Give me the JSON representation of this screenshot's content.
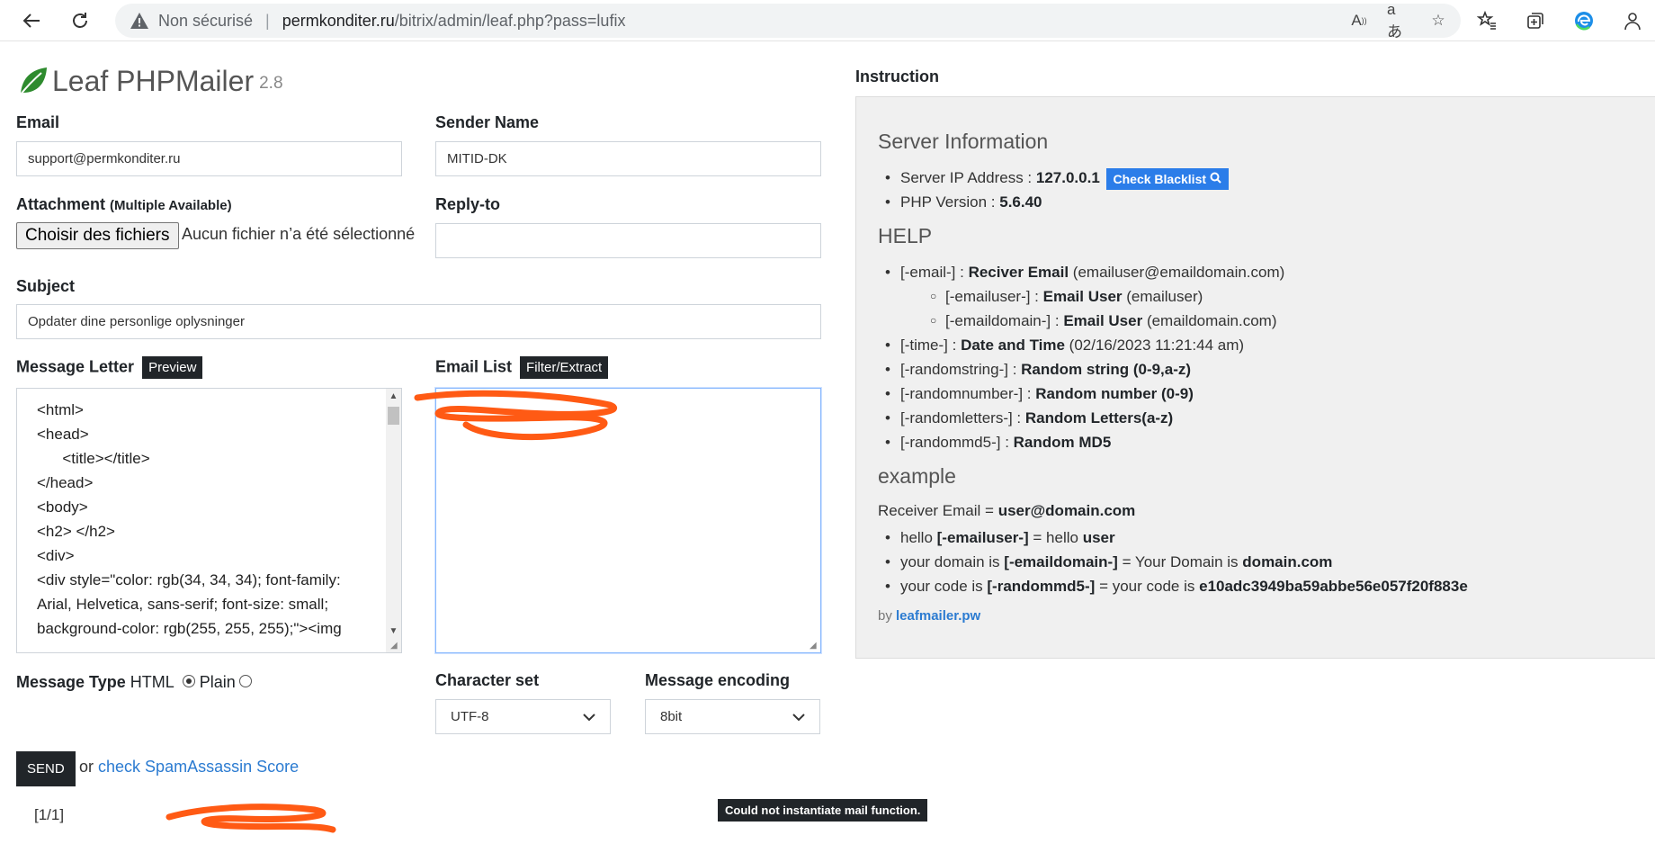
{
  "browser": {
    "insecure_label": "Non sécurisé",
    "url_host": "permkonditer.ru",
    "url_path": "/bitrix/admin/leaf.php?pass=lufix"
  },
  "app": {
    "name": "Leaf PHPMailer",
    "version": "2.8",
    "brand_color": "#2e8b2e"
  },
  "form": {
    "email_label": "Email",
    "email_value": "support@permkonditer.ru",
    "sender_label": "Sender Name",
    "sender_value": "MITID-DK",
    "attachment_label": "Attachment",
    "attachment_note": "(Multiple Available)",
    "file_button": "Choisir des fichiers",
    "file_none": "Aucun fichier n’a été sélectionné",
    "replyto_label": "Reply-to",
    "replyto_value": "",
    "subject_label": "Subject",
    "subject_value": "Opdater dine personlige oplysninger",
    "message_label": "Message Letter",
    "preview_button": "Preview",
    "message_lines": [
      "<html>",
      "<head>",
      "      <title></title>",
      "</head>",
      "<body>",
      "<h2> </h2>",
      "",
      "<div>",
      "<div style=\"color: rgb(34, 34, 34); font-family:",
      "Arial, Helvetica, sans-serif; font-size: small;",
      "background-color: rgb(255, 255, 255);\"><img"
    ],
    "emaillist_label": "Email List",
    "filter_button": "Filter/Extract",
    "message_type_label": "Message Type",
    "type_html": "HTML",
    "type_plain": "Plain",
    "charset_label": "Character set",
    "charset_value": "UTF-8",
    "encoding_label": "Message encoding",
    "encoding_value": "8bit",
    "send_button": "SEND",
    "or_text": "or",
    "spam_link": "check SpamAssassin Score"
  },
  "result": {
    "count": "[1/1]",
    "error": "Could not instantiate mail function."
  },
  "instruction": {
    "title": "Instruction",
    "server_heading": "Server Information",
    "ip_label": "Server IP Address : ",
    "ip_value": "127.0.0.1",
    "blacklist_button": "Check Blacklist",
    "php_label": "PHP Version : ",
    "php_value": "5.6.40",
    "help_heading": "HELP",
    "help_items": [
      {
        "tag": "[-email-] : ",
        "desc": "Reciver Email",
        "example": " (emailuser@emaildomain.com)",
        "sub": false
      },
      {
        "tag": "[-emailuser-] : ",
        "desc": "Email User",
        "example": " (emailuser)",
        "sub": true
      },
      {
        "tag": "[-emaildomain-] : ",
        "desc": "Email User",
        "example": " (emaildomain.com)",
        "sub": true
      },
      {
        "tag": "[-time-] : ",
        "desc": "Date and Time",
        "example": " (02/16/2023 11:21:44 am)",
        "sub": false
      },
      {
        "tag": "[-randomstring-] : ",
        "desc": "Random string (0-9,a-z)",
        "example": "",
        "sub": false
      },
      {
        "tag": "[-randomnumber-] : ",
        "desc": "Random number (0-9)",
        "example": "",
        "sub": false
      },
      {
        "tag": "[-randomletters-] : ",
        "desc": "Random Letters(a-z)",
        "example": "",
        "sub": false
      },
      {
        "tag": "[-randommd5-] : ",
        "desc": "Random MD5",
        "example": "",
        "sub": false
      }
    ],
    "example_heading": "example",
    "receiver_label": "Receiver Email = ",
    "receiver_value": "user@domain.com",
    "examples": [
      {
        "a": "hello ",
        "b": "[-emailuser-]",
        "c": " = hello ",
        "d": "user"
      },
      {
        "a": "your domain is ",
        "b": "[-emaildomain-]",
        "c": " = Your Domain is ",
        "d": "domain.com"
      },
      {
        "a": "your code is ",
        "b": "[-randommd5-]",
        "c": " = your code is ",
        "d": "e10adc3949ba59abbe56e057f20f883e"
      }
    ],
    "by_label": "by",
    "by_link": "leafmailer.pw"
  }
}
